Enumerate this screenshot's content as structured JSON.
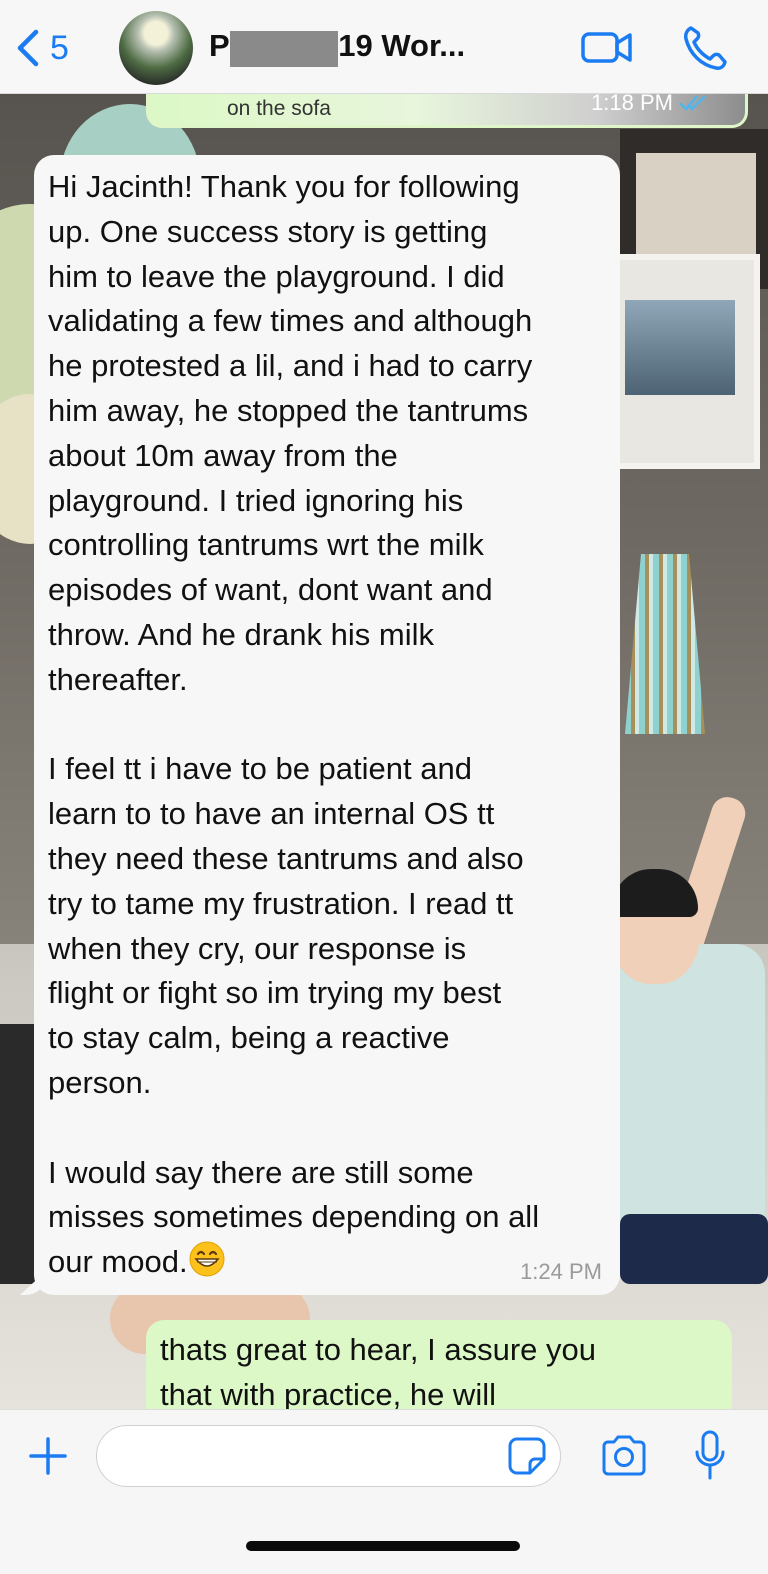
{
  "header": {
    "back_count": "5",
    "contact_name": "Pa          l Sep 19 Wor...",
    "accent_color": "#1b7cf2"
  },
  "messages": {
    "previous_snippet": "on the sofa",
    "previous_time": "1:18 PM",
    "incoming": {
      "paragraph1": "Hi Jacinth! Thank you for following\nup. One success story is getting\nhim to leave the playground. I did\nvalidating a few times and although\nhe protested a lil, and i had to carry\nhim away, he stopped the tantrums\nabout 10m away from the\nplayground. I tried ignoring his\ncontrolling tantrums wrt the milk\nepisodes of want, dont want and\nthrow. And he drank his milk\nthereafter.",
      "paragraph2": "I feel tt i have to be patient and\nlearn to to have an internal OS tt\nthey need these tantrums and also\ntry to tame my frustration. I read tt\nwhen they cry, our response is\nflight or fight so im trying my best\nto stay calm, being a reactive\nperson.",
      "paragraph3": "I would say there are still some\nmisses sometimes depending on all\nour mood.",
      "emoji": "grinning-face",
      "time": "1:24 PM"
    },
    "outgoing": {
      "text": "thats great to hear, I assure you\nthat with practice, he will"
    }
  },
  "input_bar": {
    "placeholder": ""
  }
}
